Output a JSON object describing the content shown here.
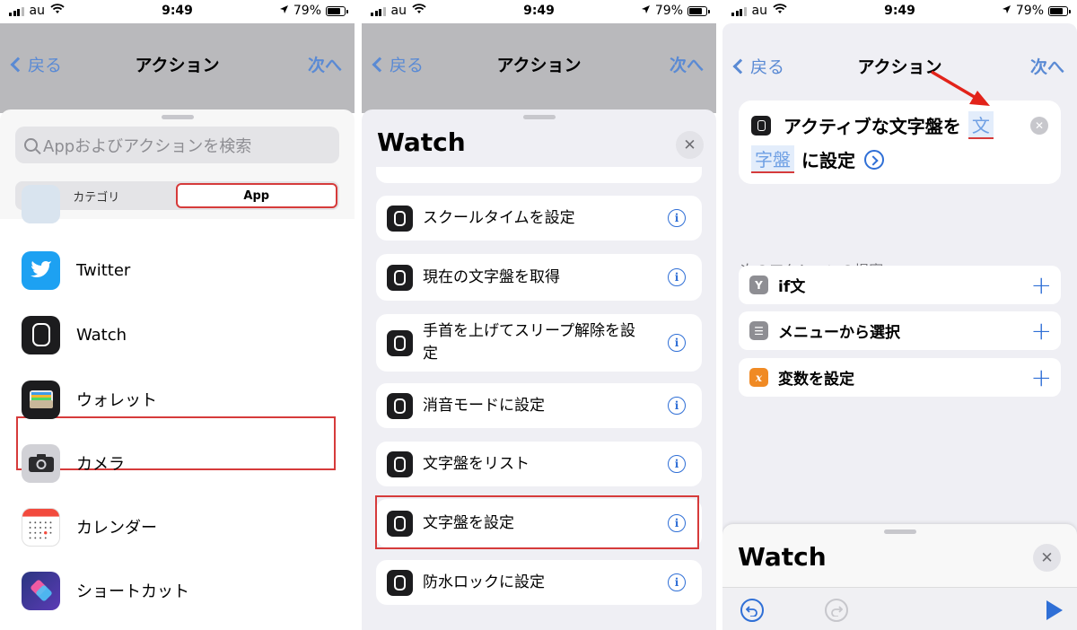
{
  "status": {
    "carrier": "au",
    "time": "9:49",
    "battery": "79%"
  },
  "nav": {
    "back": "戻る",
    "title": "アクション",
    "next": "次へ"
  },
  "panel1": {
    "search_placeholder": "Appおよびアクションを検索",
    "segments": [
      "カテゴリ",
      "App"
    ],
    "apps": [
      "Twitter",
      "Watch",
      "ウォレット",
      "カメラ",
      "カレンダー",
      "ショートカット"
    ]
  },
  "panel2": {
    "title": "Watch",
    "close": "✕",
    "actions": [
      "スクールタイムを設定",
      "現在の文字盤を取得",
      "手首を上げてスリープ解除を設定",
      "消音モードに設定",
      "文字盤をリスト",
      "文字盤を設定",
      "防水ロックに設定"
    ],
    "info": "i"
  },
  "panel3": {
    "card_text1": "アクティブな文字盤を",
    "token1": "文",
    "token2": "字盤",
    "card_text2": "に設定",
    "suggestions_header": "次のアクションの提案",
    "suggestions": [
      {
        "label": "if文",
        "icon": "Y",
        "color": "#8e8e93"
      },
      {
        "label": "メニューから選択",
        "icon": "☰",
        "color": "#8e8e93"
      },
      {
        "label": "変数を設定",
        "icon": "x",
        "color": "#f08a24"
      }
    ],
    "plus": "+",
    "bottom_title": "Watch",
    "close": "✕"
  },
  "colors": {
    "accent": "#2f6fd6",
    "highlight": "#d63b3b"
  }
}
